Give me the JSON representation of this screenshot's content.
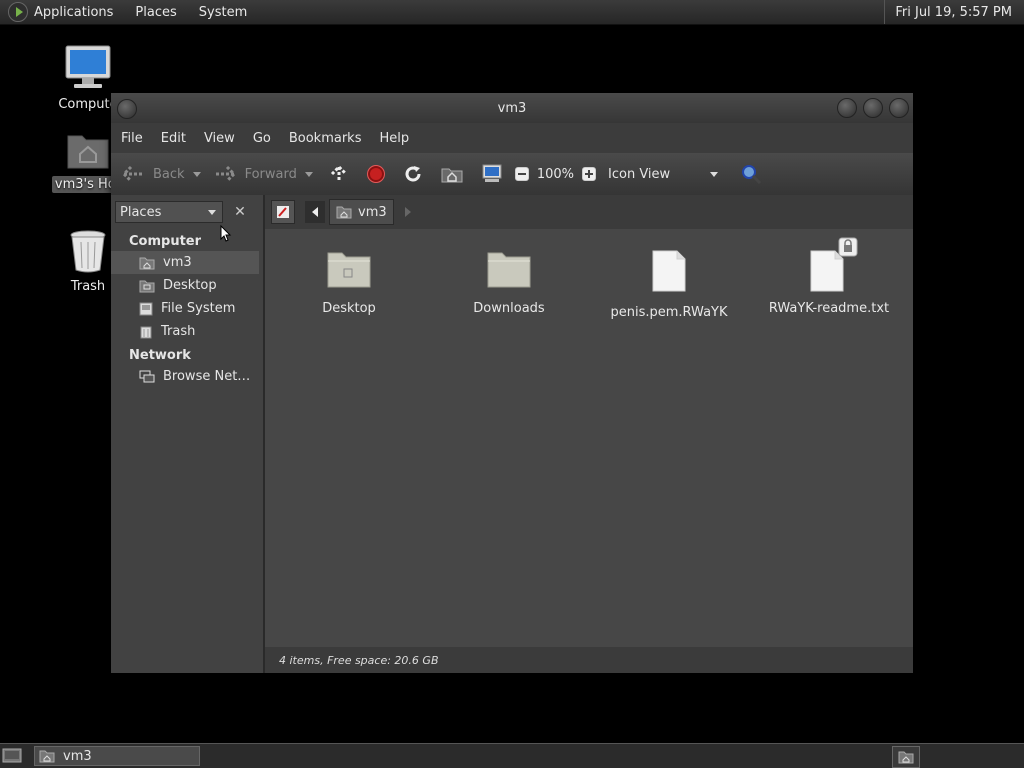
{
  "top_panel": {
    "menus": [
      "Applications",
      "Places",
      "System"
    ],
    "clock": "Fri Jul 19,  5:57 PM"
  },
  "desktop": {
    "icons": [
      {
        "label": "Compute",
        "icon": "computer-icon"
      },
      {
        "label": "vm3's Hor",
        "icon": "home-folder-icon"
      },
      {
        "label": "Trash",
        "icon": "trash-icon"
      }
    ]
  },
  "window": {
    "title": "vm3",
    "menu": [
      "File",
      "Edit",
      "View",
      "Go",
      "Bookmarks",
      "Help"
    ],
    "toolbar": {
      "back": "Back",
      "forward": "Forward",
      "zoom": "100%",
      "view_mode": "Icon View"
    },
    "sidebar": {
      "selector": "Places",
      "sections": [
        {
          "heading": "Computer",
          "items": [
            "vm3",
            "Desktop",
            "File System",
            "Trash"
          ]
        },
        {
          "heading": "Network",
          "items": [
            "Browse Net…"
          ]
        }
      ],
      "selected": "vm3"
    },
    "path": {
      "current": "vm3"
    },
    "files": [
      {
        "name": "Desktop",
        "icon": "desktop-folder-icon"
      },
      {
        "name": "Downloads",
        "icon": "folder-icon"
      },
      {
        "name": "penis.pem.RWaYK",
        "icon": "document-icon"
      },
      {
        "name": "RWaYK-readme.txt",
        "icon": "locked-document-icon"
      }
    ],
    "status": "4 items, Free space: 20.6 GB"
  },
  "taskbar": {
    "task_label": "vm3"
  }
}
